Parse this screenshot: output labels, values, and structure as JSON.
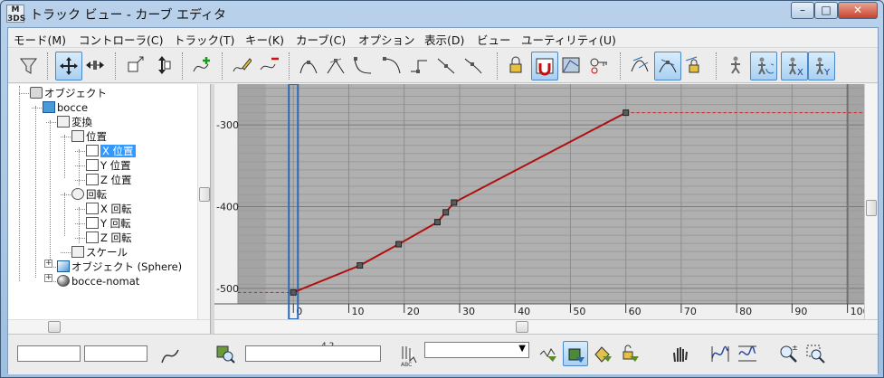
{
  "window": {
    "app_icon_text": "M 3DS",
    "title": "トラック ビュー - カーブ エディタ",
    "minimize": "–",
    "maximize": "□",
    "close": "✕"
  },
  "menu": [
    "モード(M)",
    "コントローラ(C)",
    "トラック(T)",
    "キー(K)",
    "カーブ(C)",
    "オプション",
    "表示(D)",
    "ビュー",
    "ユーティリティ(U)"
  ],
  "toolbar": {
    "buttons": [
      "filter-icon",
      "move-keys-icon",
      "slide-keys-icon",
      "scale-keys-icon",
      "scale-values-icon",
      "add-keys-icon",
      "draw-curves-icon",
      "reduce-keys-icon",
      "tangent-auto-icon",
      "tangent-custom-icon",
      "tangent-fast-icon",
      "tangent-slow-icon",
      "tangent-step-icon",
      "tangent-linear-icon",
      "tangent-smooth-icon",
      "lock-selection-icon",
      "snap-frames-icon",
      "parameter-curve-icon",
      "show-keyable-icon",
      "show-all-tangents-icon",
      "show-tangents-icon",
      "lock-tangents-icon",
      "isolate-curve-icon",
      "show-biped-position-icon",
      "show-biped-x-icon",
      "show-biped-y-icon"
    ],
    "active": [
      "move-keys-icon",
      "snap-frames-icon",
      "show-tangents-icon",
      "show-biped-position-icon",
      "show-biped-x-icon",
      "show-biped-y-icon"
    ]
  },
  "tree": {
    "nodes": [
      {
        "label": "オブジェクト",
        "icon": "object-icon"
      },
      {
        "label": "bocce",
        "icon": "box-object-icon"
      },
      {
        "label": "変換",
        "icon": "transform-icon"
      },
      {
        "label": "位置",
        "icon": "position-icon"
      },
      {
        "label": "X 位置",
        "icon": "curve-track-icon",
        "selected": true
      },
      {
        "label": "Y 位置",
        "icon": "curve-track-icon"
      },
      {
        "label": "Z 位置",
        "icon": "curve-track-icon"
      },
      {
        "label": "回転",
        "icon": "rotation-icon"
      },
      {
        "label": "X 回転",
        "icon": "curve-track-icon"
      },
      {
        "label": "Y 回転",
        "icon": "curve-track-icon"
      },
      {
        "label": "Z 回転",
        "icon": "curve-track-icon"
      },
      {
        "label": "スケール",
        "icon": "scale-icon"
      },
      {
        "label": "オブジェクト (Sphere)",
        "icon": "sphere-object-icon"
      },
      {
        "label": "bocce-nomat",
        "icon": "material-icon"
      }
    ]
  },
  "graph": {
    "y_ticks": [
      "-300",
      "-400",
      "-500"
    ],
    "x_ticks": [
      "0",
      "10",
      "20",
      "30",
      "40",
      "50",
      "60",
      "70",
      "80",
      "90",
      "100"
    ],
    "xlim": [
      -10,
      103
    ],
    "ylim": [
      -519,
      -250
    ],
    "current_frame": 0,
    "curve_color": "#b01010",
    "out_of_range_color": "#d02020",
    "background": "#a4a4a4",
    "active_range_background": "#b0b0b0"
  },
  "chart_data": {
    "type": "line",
    "title": "",
    "xlabel": "",
    "ylabel": "",
    "xlim": [
      -10,
      103
    ],
    "ylim": [
      -519,
      -250
    ],
    "x": [
      0,
      12,
      19,
      26,
      27.5,
      29,
      60
    ],
    "y": [
      -505,
      -472,
      -446,
      -419,
      -407,
      -395,
      -285
    ],
    "keys_x": [
      0,
      12,
      19,
      26,
      27.5,
      29,
      60
    ]
  },
  "status": {
    "field_left_1": "",
    "field_left_2": "",
    "key_value_label": "4.2",
    "name_field": "",
    "select_set": "",
    "abc_label": "ABC"
  }
}
